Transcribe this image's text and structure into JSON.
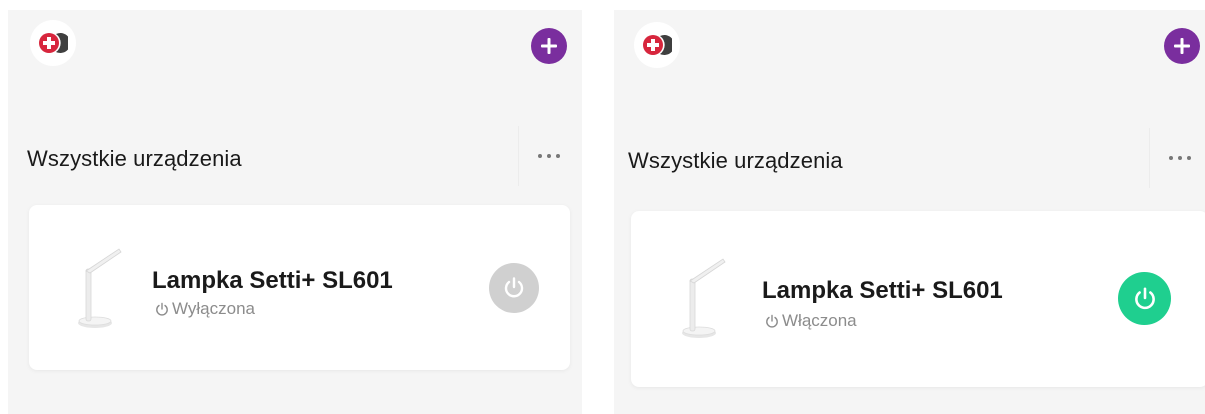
{
  "panels": [
    {
      "logo_icon": "red-plus-logo-icon",
      "add_icon": "plus-icon",
      "section_title": "Wszystkie urządzenia",
      "more_icon": "more-dots-icon",
      "device": {
        "name": "Lampka Setti+ SL601",
        "status": "Wyłączona",
        "status_icon": "power-small-icon",
        "image": "desk-lamp-icon",
        "power_on": false,
        "power_color": "#d0d0d0"
      }
    },
    {
      "logo_icon": "red-plus-logo-icon",
      "add_icon": "plus-icon",
      "section_title": "Wszystkie urządzenia",
      "more_icon": "more-dots-icon",
      "device": {
        "name": "Lampka Setti+ SL601",
        "status": "Włączona",
        "status_icon": "power-small-icon",
        "image": "desk-lamp-icon",
        "power_on": true,
        "power_color": "#1fcf8f"
      }
    }
  ],
  "colors": {
    "accent_purple": "#7a2e9e",
    "logo_red": "#d7263d",
    "power_off": "#d0d0d0",
    "power_on": "#1fcf8f"
  }
}
